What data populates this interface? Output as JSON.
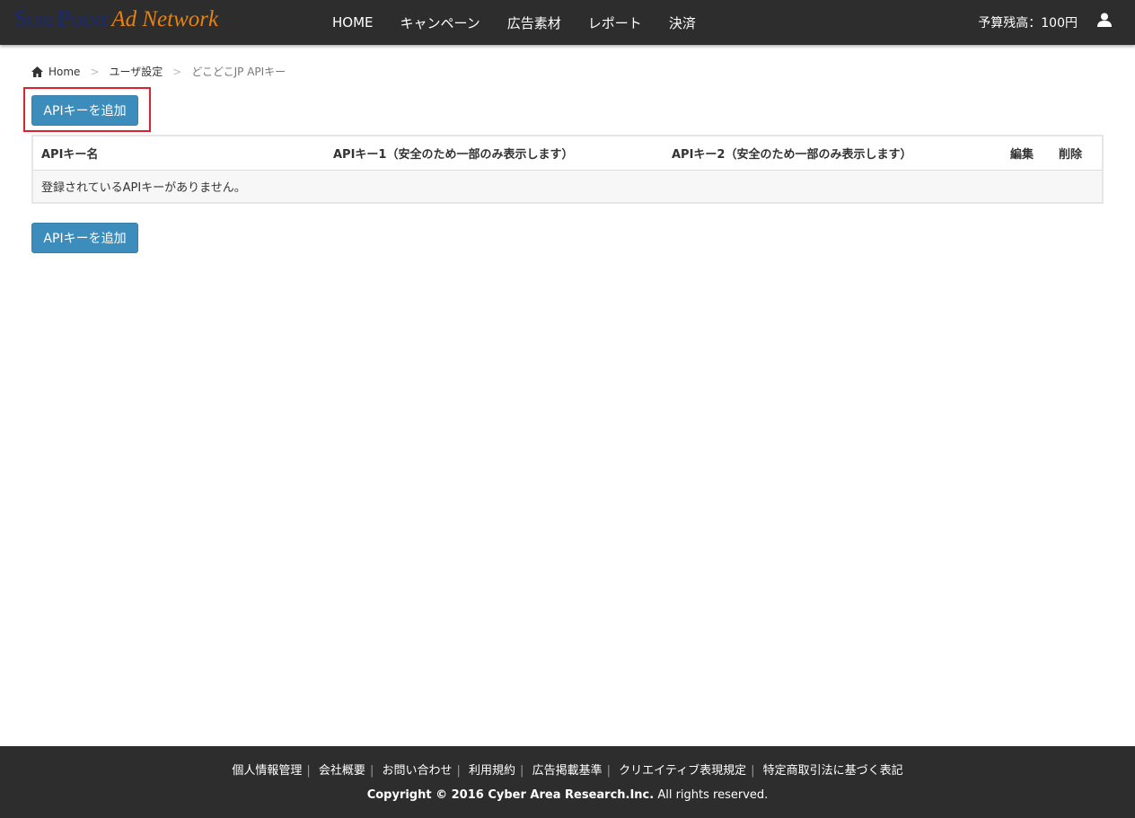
{
  "header": {
    "logo_main": "SurfPoint",
    "logo_sub": "Ad Network",
    "menu": [
      "HOME",
      "キャンペーン",
      "広告素材",
      "レポート",
      "決済"
    ],
    "budget": "予算残高：100円"
  },
  "breadcrumb": [
    "Home",
    "ユーザ設定",
    "どこどこJP APIキー"
  ],
  "add_button": "APIキーを追加",
  "table": {
    "headers": [
      "APIキー名",
      "APIキー1（安全のため一部のみ表示します）",
      "APIキー2（安全のため一部のみ表示します）",
      "編集",
      "削除"
    ],
    "empty": "登録されているAPIキーがありません。"
  },
  "footer": {
    "links": [
      "個人情報管理",
      "会社概要",
      "お問い合わせ",
      "利用規約",
      "広告掲載基準",
      "クリエイティブ表現規定",
      "特定商取引法に基づく表記"
    ],
    "copyright_bold": "Copyright © 2016 Cyber Area Research.Inc.",
    "copyright_rest": " All rights reserved."
  }
}
